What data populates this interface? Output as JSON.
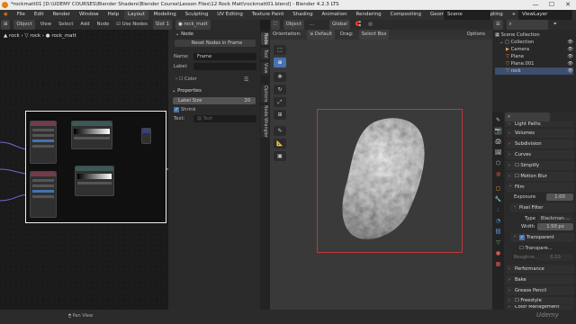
{
  "window": {
    "title": "*rockmatt01 [D:\\UDEMY COURSES\\Blender Shaders\\Blender Course\\Lesson Files\\12 Rock Matt\\rockmatt01.blend] - Blender 4.2.3 LTS",
    "minimize": "—",
    "maximize": "☐",
    "close": "✕"
  },
  "menubar": {
    "items": [
      "File",
      "Edit",
      "Render",
      "Window",
      "Help"
    ],
    "workspaces": [
      "Layout",
      "Modeling",
      "Sculpting",
      "UV Editing",
      "Texture Paint",
      "Shading",
      "Animation",
      "Rendering",
      "Compositing",
      "Geometry Nodes",
      "Scripting"
    ],
    "active_workspace": "Layout",
    "scene": "Scene",
    "view_layer": "ViewLayer"
  },
  "node_editor": {
    "header": {
      "editor_type": "⊞",
      "mode": "Object",
      "menus": [
        "View",
        "Select",
        "Add",
        "Node"
      ],
      "use_nodes_label": "Use Nodes",
      "slot": "Slot 1",
      "material": "rock_matt"
    },
    "breadcrumb": [
      "rock",
      "rock",
      "rock_matt"
    ]
  },
  "n_panel": {
    "section_node": "Node",
    "reset_button": "Reset Nodes in Frame",
    "name_label": "Name:",
    "name_value": "Frame",
    "label_label": "Label:",
    "label_value": "",
    "color_section": "Color",
    "properties_section": "Properties",
    "label_size_label": "Label Size",
    "label_size_value": "20",
    "shrink_label": "Shrink",
    "text_label": "Text:",
    "text_placeholder": "Text"
  },
  "vertical_tabs": [
    "Node",
    "Tool",
    "View",
    "Options",
    "Node Wrangler"
  ],
  "viewport": {
    "header": {
      "mode": "Object",
      "orientation_label": "Orientation:",
      "orientation_value": "Default",
      "drag_label": "Drag:",
      "drag_value": "Select Box",
      "transform_space": "Global",
      "options_label": "Options"
    }
  },
  "outliner": {
    "title": "Scene Collection",
    "items": [
      {
        "label": "Collection"
      },
      {
        "label": "Camera"
      },
      {
        "label": "Plane"
      },
      {
        "label": "Plane.001"
      },
      {
        "label": "rock"
      }
    ]
  },
  "properties": {
    "top_sections": [
      "Light Paths",
      "Volumes",
      "Subdivision",
      "Curves",
      "Simplify",
      "Motion Blur"
    ],
    "film_section": "Film",
    "exposure_label": "Exposure",
    "exposure_value": "1.00",
    "pixel_filter_section": "Pixel Filter",
    "type_label": "Type",
    "type_value": "Blackman-...",
    "width_label": "Width",
    "width_value": "1.50 px",
    "transparent_label": "Transparent",
    "transparent_glass_label": "Transpare...",
    "roughness_label": "Roughne...",
    "roughness_value": "0.10",
    "bottom_sections": [
      "Performance",
      "Bake",
      "Grease Pencil",
      "Freestyle",
      "Color Management"
    ]
  },
  "statusbar": {
    "pan_view": "Pan View",
    "watermark": "Udemy"
  },
  "colors": {
    "accent": "#4772b3",
    "frame_border": "#f0f0f0",
    "camera_frame": "#c0383a",
    "blender_orange": "#e87d0d"
  }
}
